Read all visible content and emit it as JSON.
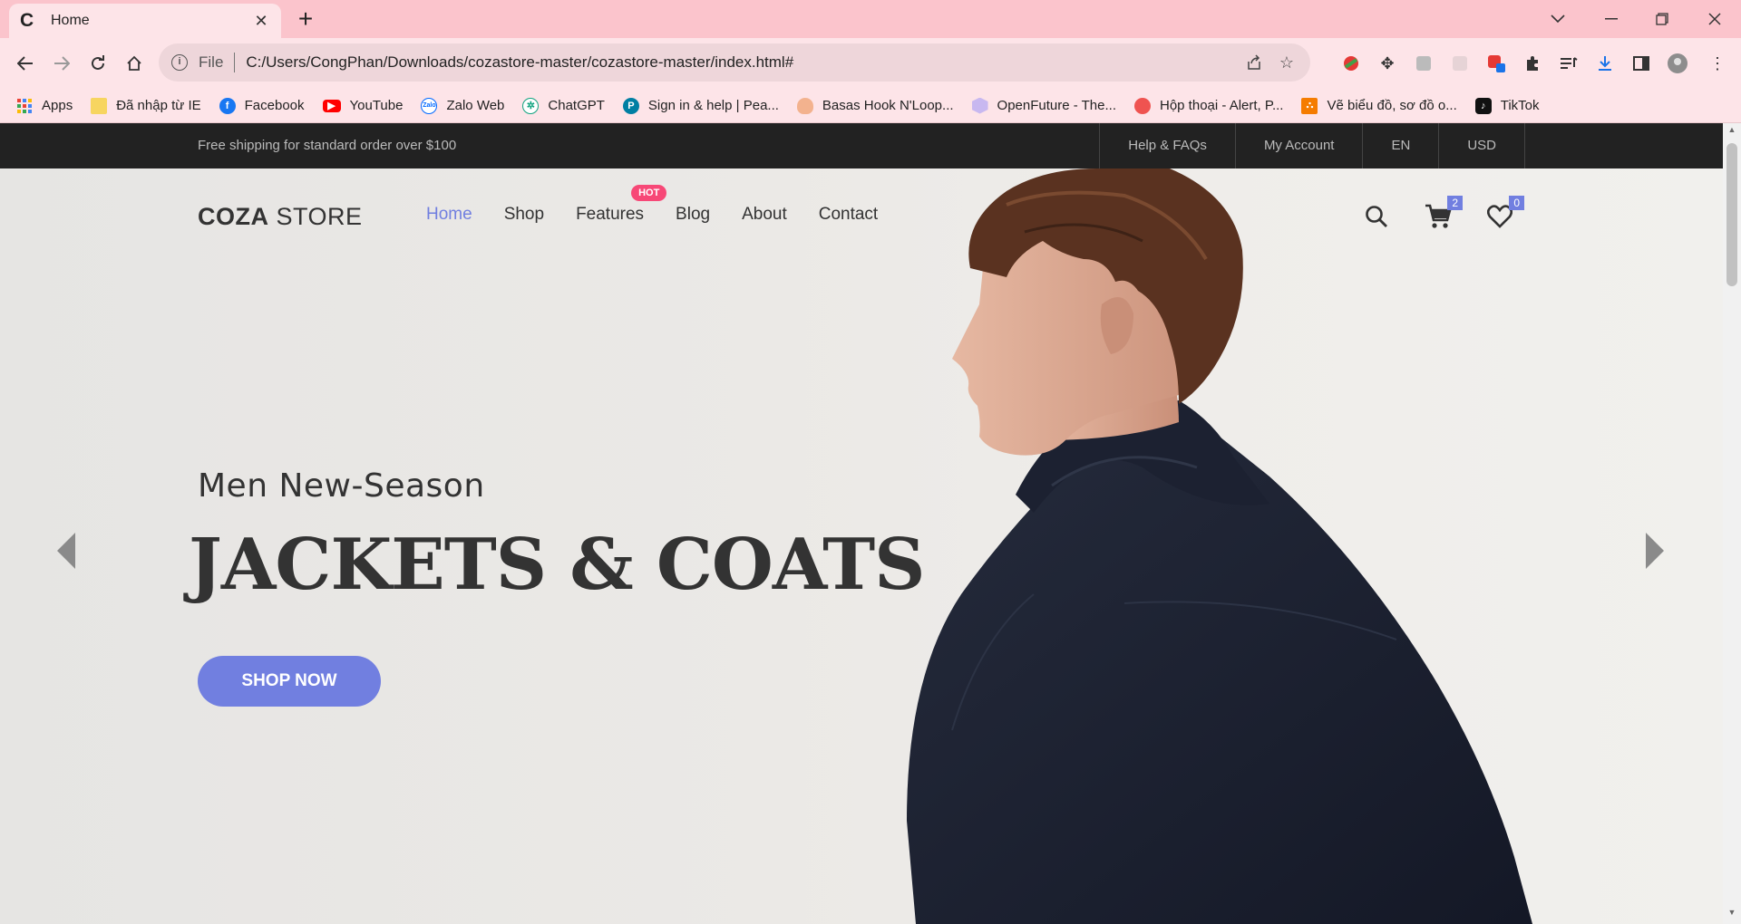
{
  "browser": {
    "tab_title": "Home",
    "tab_favicon": "C",
    "address_scheme": "File",
    "url": "C:/Users/CongPhan/Downloads/cozastore-master/cozastore-master/index.html#",
    "bookmarks": [
      {
        "label": "Apps",
        "icon": "apps-grid-icon",
        "color": "#4285f4"
      },
      {
        "label": "Đã nhập từ IE",
        "icon": "folder-icon",
        "color": "#f7d560"
      },
      {
        "label": "Facebook",
        "icon": "facebook-icon",
        "color": "#1877f2"
      },
      {
        "label": "YouTube",
        "icon": "youtube-icon",
        "color": "#ff0000"
      },
      {
        "label": "Zalo Web",
        "icon": "zalo-icon",
        "color": "#0068ff"
      },
      {
        "label": "ChatGPT",
        "icon": "chatgpt-icon",
        "color": "#10a37f"
      },
      {
        "label": "Sign in & help | Pea...",
        "icon": "pearson-icon",
        "color": "#007fa3"
      },
      {
        "label": "Basas Hook N'Loop...",
        "icon": "pineapple-icon",
        "color": "#e8a07a"
      },
      {
        "label": "OpenFuture - The...",
        "icon": "openfuture-icon",
        "color": "#b7a8e8"
      },
      {
        "label": "Hộp thoại - Alert, P...",
        "icon": "alert-icon",
        "color": "#ef5350"
      },
      {
        "label": "Vẽ biểu đồ, sơ đồ o...",
        "icon": "diagram-icon",
        "color": "#f57c00"
      },
      {
        "label": "TikTok",
        "icon": "tiktok-icon",
        "color": "#111111"
      }
    ]
  },
  "site": {
    "topbar": {
      "promo": "Free shipping for standard order over $100",
      "links": [
        "Help & FAQs",
        "My Account",
        "EN",
        "USD"
      ]
    },
    "logo_bold": "COZA",
    "logo_light": " STORE",
    "nav": [
      {
        "label": "Home",
        "active": true
      },
      {
        "label": "Shop",
        "active": false
      },
      {
        "label": "Features",
        "active": false,
        "badge": "HOT"
      },
      {
        "label": "Blog",
        "active": false
      },
      {
        "label": "About",
        "active": false
      },
      {
        "label": "Contact",
        "active": false
      }
    ],
    "cart_count": "2",
    "wishlist_count": "0",
    "hero": {
      "subtitle": "Men New-Season",
      "headline": "JACKETS & COATS",
      "button": "SHOP NOW"
    },
    "colors": {
      "accent": "#717fe0",
      "hot_badge": "#f74877",
      "topbar": "#222222"
    }
  }
}
